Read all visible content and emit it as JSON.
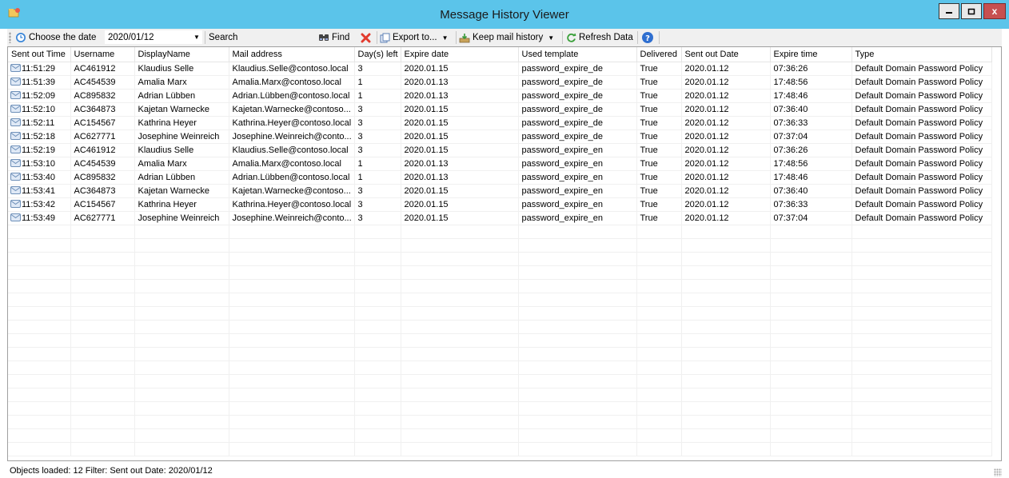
{
  "window": {
    "title": "Message History Viewer",
    "close_glyph": "x"
  },
  "toolbar": {
    "choose_date_label": "Choose the date",
    "date_value": "2020/01/12",
    "search_label": "Search",
    "find_label": "Find",
    "export_label": "Export to...",
    "keep_history_label": "Keep mail history",
    "refresh_label": "Refresh Data"
  },
  "columns": [
    "Sent out Time",
    "Username",
    "DisplayName",
    "Mail address",
    "Day(s) left",
    "Expire date",
    "Used template",
    "Delivered",
    "Sent out Date",
    "Expire time",
    "Type"
  ],
  "rows": [
    [
      "11:51:29",
      "AC461912",
      "Klaudius Selle",
      "Klaudius.Selle@contoso.local",
      "3",
      "2020.01.15",
      "password_expire_de",
      "True",
      "2020.01.12",
      "07:36:26",
      "Default Domain Password Policy"
    ],
    [
      "11:51:39",
      "AC454539",
      "Amalia Marx",
      "Amalia.Marx@contoso.local",
      "1",
      "2020.01.13",
      "password_expire_de",
      "True",
      "2020.01.12",
      "17:48:56",
      "Default Domain Password Policy"
    ],
    [
      "11:52:09",
      "AC895832",
      "Adrian Lübben",
      "Adrian.Lübben@contoso.local",
      "1",
      "2020.01.13",
      "password_expire_de",
      "True",
      "2020.01.12",
      "17:48:46",
      "Default Domain Password Policy"
    ],
    [
      "11:52:10",
      "AC364873",
      "Kajetan Warnecke",
      "Kajetan.Warnecke@contoso...",
      "3",
      "2020.01.15",
      "password_expire_de",
      "True",
      "2020.01.12",
      "07:36:40",
      "Default Domain Password Policy"
    ],
    [
      "11:52:11",
      "AC154567",
      "Kathrina Heyer",
      "Kathrina.Heyer@contoso.local",
      "3",
      "2020.01.15",
      "password_expire_de",
      "True",
      "2020.01.12",
      "07:36:33",
      "Default Domain Password Policy"
    ],
    [
      "11:52:18",
      "AC627771",
      "Josephine Weinreich",
      "Josephine.Weinreich@conto...",
      "3",
      "2020.01.15",
      "password_expire_de",
      "True",
      "2020.01.12",
      "07:37:04",
      "Default Domain Password Policy"
    ],
    [
      "11:52:19",
      "AC461912",
      "Klaudius Selle",
      "Klaudius.Selle@contoso.local",
      "3",
      "2020.01.15",
      "password_expire_en",
      "True",
      "2020.01.12",
      "07:36:26",
      "Default Domain Password Policy"
    ],
    [
      "11:53:10",
      "AC454539",
      "Amalia Marx",
      "Amalia.Marx@contoso.local",
      "1",
      "2020.01.13",
      "password_expire_en",
      "True",
      "2020.01.12",
      "17:48:56",
      "Default Domain Password Policy"
    ],
    [
      "11:53:40",
      "AC895832",
      "Adrian Lübben",
      "Adrian.Lübben@contoso.local",
      "1",
      "2020.01.13",
      "password_expire_en",
      "True",
      "2020.01.12",
      "17:48:46",
      "Default Domain Password Policy"
    ],
    [
      "11:53:41",
      "AC364873",
      "Kajetan Warnecke",
      "Kajetan.Warnecke@contoso...",
      "3",
      "2020.01.15",
      "password_expire_en",
      "True",
      "2020.01.12",
      "07:36:40",
      "Default Domain Password Policy"
    ],
    [
      "11:53:42",
      "AC154567",
      "Kathrina Heyer",
      "Kathrina.Heyer@contoso.local",
      "3",
      "2020.01.15",
      "password_expire_en",
      "True",
      "2020.01.12",
      "07:36:33",
      "Default Domain Password Policy"
    ],
    [
      "11:53:49",
      "AC627771",
      "Josephine Weinreich",
      "Josephine.Weinreich@conto...",
      "3",
      "2020.01.15",
      "password_expire_en",
      "True",
      "2020.01.12",
      "07:37:04",
      "Default Domain Password Policy"
    ]
  ],
  "status": {
    "text": "Objects loaded:  12  Filter:  Sent out Date: 2020/01/12"
  },
  "icons": {
    "app": "folder-app-icon",
    "clock": "clock-icon",
    "find": "binoculars-icon",
    "clear": "red-x-icon",
    "export": "export-icon",
    "keep": "inbox-icon",
    "refresh": "refresh-icon",
    "help": "help-icon",
    "row": "mail-icon"
  },
  "colors": {
    "titlebar": "#5bc4ea",
    "close_button": "#c75050"
  }
}
